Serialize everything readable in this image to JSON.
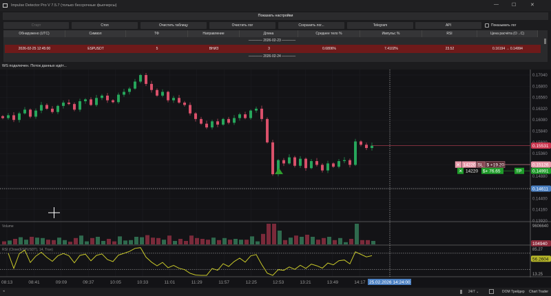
{
  "window": {
    "title": "Impulse Detector Pro V 7.5.7 (только бессрочные фьючерсы)",
    "minimize": "—",
    "maximize": "☐",
    "close": "✕"
  },
  "settings_toggle": "Показать настройки",
  "toolbar": {
    "start": "Старт",
    "stop": "Стоп",
    "clear_table": "Очистить таблицу",
    "clear_log": "Очистить лог",
    "save_log": "Сохранить лог...",
    "telegram": "Telegram",
    "api": "API",
    "show_log": "Показывать лог",
    "show_log_checked": false
  },
  "table": {
    "headers": [
      "Обнаружено (UTC)",
      "Символ",
      "ТФ",
      "Направление",
      "Длина",
      "Среднее тело %",
      "Импульс %",
      "RSI",
      "Цена расчёта (O→C)"
    ],
    "separators": [
      "———— 2026-02-23 ————",
      "———— 2026-02-24 ————"
    ],
    "rows": [
      [
        "2026-02-25 12:45:00",
        "ESPUSDT",
        "5",
        "ВНИЗ",
        "3",
        "0.6806%",
        "7.4102%",
        "23.52",
        "0.16194 → 0.14994"
      ]
    ]
  },
  "status": "WS подключен. Поток данных идёт...",
  "chart": {
    "symbol": "ESPUSDT",
    "price_ticks": [
      "0.17040",
      "0.16800",
      "0.16560",
      "0.16320",
      "0.16080",
      "0.15840",
      "0.15600",
      "0.15360",
      "0.15120",
      "0.14880",
      "0.14640",
      "0.14400",
      "0.14160",
      "0.13920"
    ],
    "closes": [
      0.1612,
      0.1618,
      0.1608,
      0.1622,
      0.163,
      0.1615,
      0.1628,
      0.164,
      0.1632,
      0.1625,
      0.1638,
      0.1645,
      0.1642,
      0.163,
      0.1648,
      0.1652,
      0.164,
      0.1655,
      0.166,
      0.165,
      0.1646,
      0.1662,
      0.1668,
      0.1675,
      0.169,
      0.1704,
      0.1685,
      0.1672,
      0.166,
      0.1668,
      0.165,
      0.1655,
      0.1645,
      0.164,
      0.1622,
      0.161,
      0.16,
      0.1592,
      0.1605,
      0.1598,
      0.161,
      0.1602,
      0.1612,
      0.162,
      0.1612,
      0.1628,
      0.1632,
      0.161,
      0.156,
      0.1492,
      0.1522,
      0.1515,
      0.1528,
      0.151,
      0.1525,
      0.1505,
      0.152,
      0.1512,
      0.15,
      0.1515,
      0.1508,
      0.152,
      0.1522,
      0.1512,
      0.1562,
      0.1555,
      0.1548,
      0.1553
    ],
    "last_price": "0.15531",
    "sl_price": "0.15126",
    "tp_price": "0.14991",
    "crosshair_price": "0.14611",
    "sl_order": {
      "close": "✕",
      "qty": "14220",
      "label": "SL",
      "pnl": "$ +19.20"
    },
    "tp_order": {
      "close": "✕",
      "qty": "14220",
      "pnl": "$+ 76.65",
      "label": "TP"
    },
    "volume_label": "Volume",
    "volume_top": "9606640",
    "volume_last": "104940",
    "rsi_label": "RSI (Close(ESPUSDT), 14, True)",
    "rsi_top": "85.27",
    "rsi_bottom": "13.25",
    "rsi_last": "56.2604",
    "time_ticks": [
      "08:13",
      "08:41",
      "09:09",
      "09:37",
      "10:05",
      "10:33",
      "11:01",
      "11:29",
      "11:57",
      "12:25",
      "12:53",
      "13:21",
      "13:49",
      "14:17"
    ],
    "crosshair_time": "25.02.2026 14:24:00",
    "colors": {
      "up": "#26a65b",
      "down": "#d9506a",
      "rsi": "#c8c82a",
      "sl": "#e88a9c",
      "tp": "#1f9c2a",
      "crosshair": "#4a7fc1"
    }
  },
  "bottom_bar": {
    "session": "24/7 ⌄",
    "dom": "DOM Трейдер",
    "chart_trader": "Chart Trader"
  }
}
